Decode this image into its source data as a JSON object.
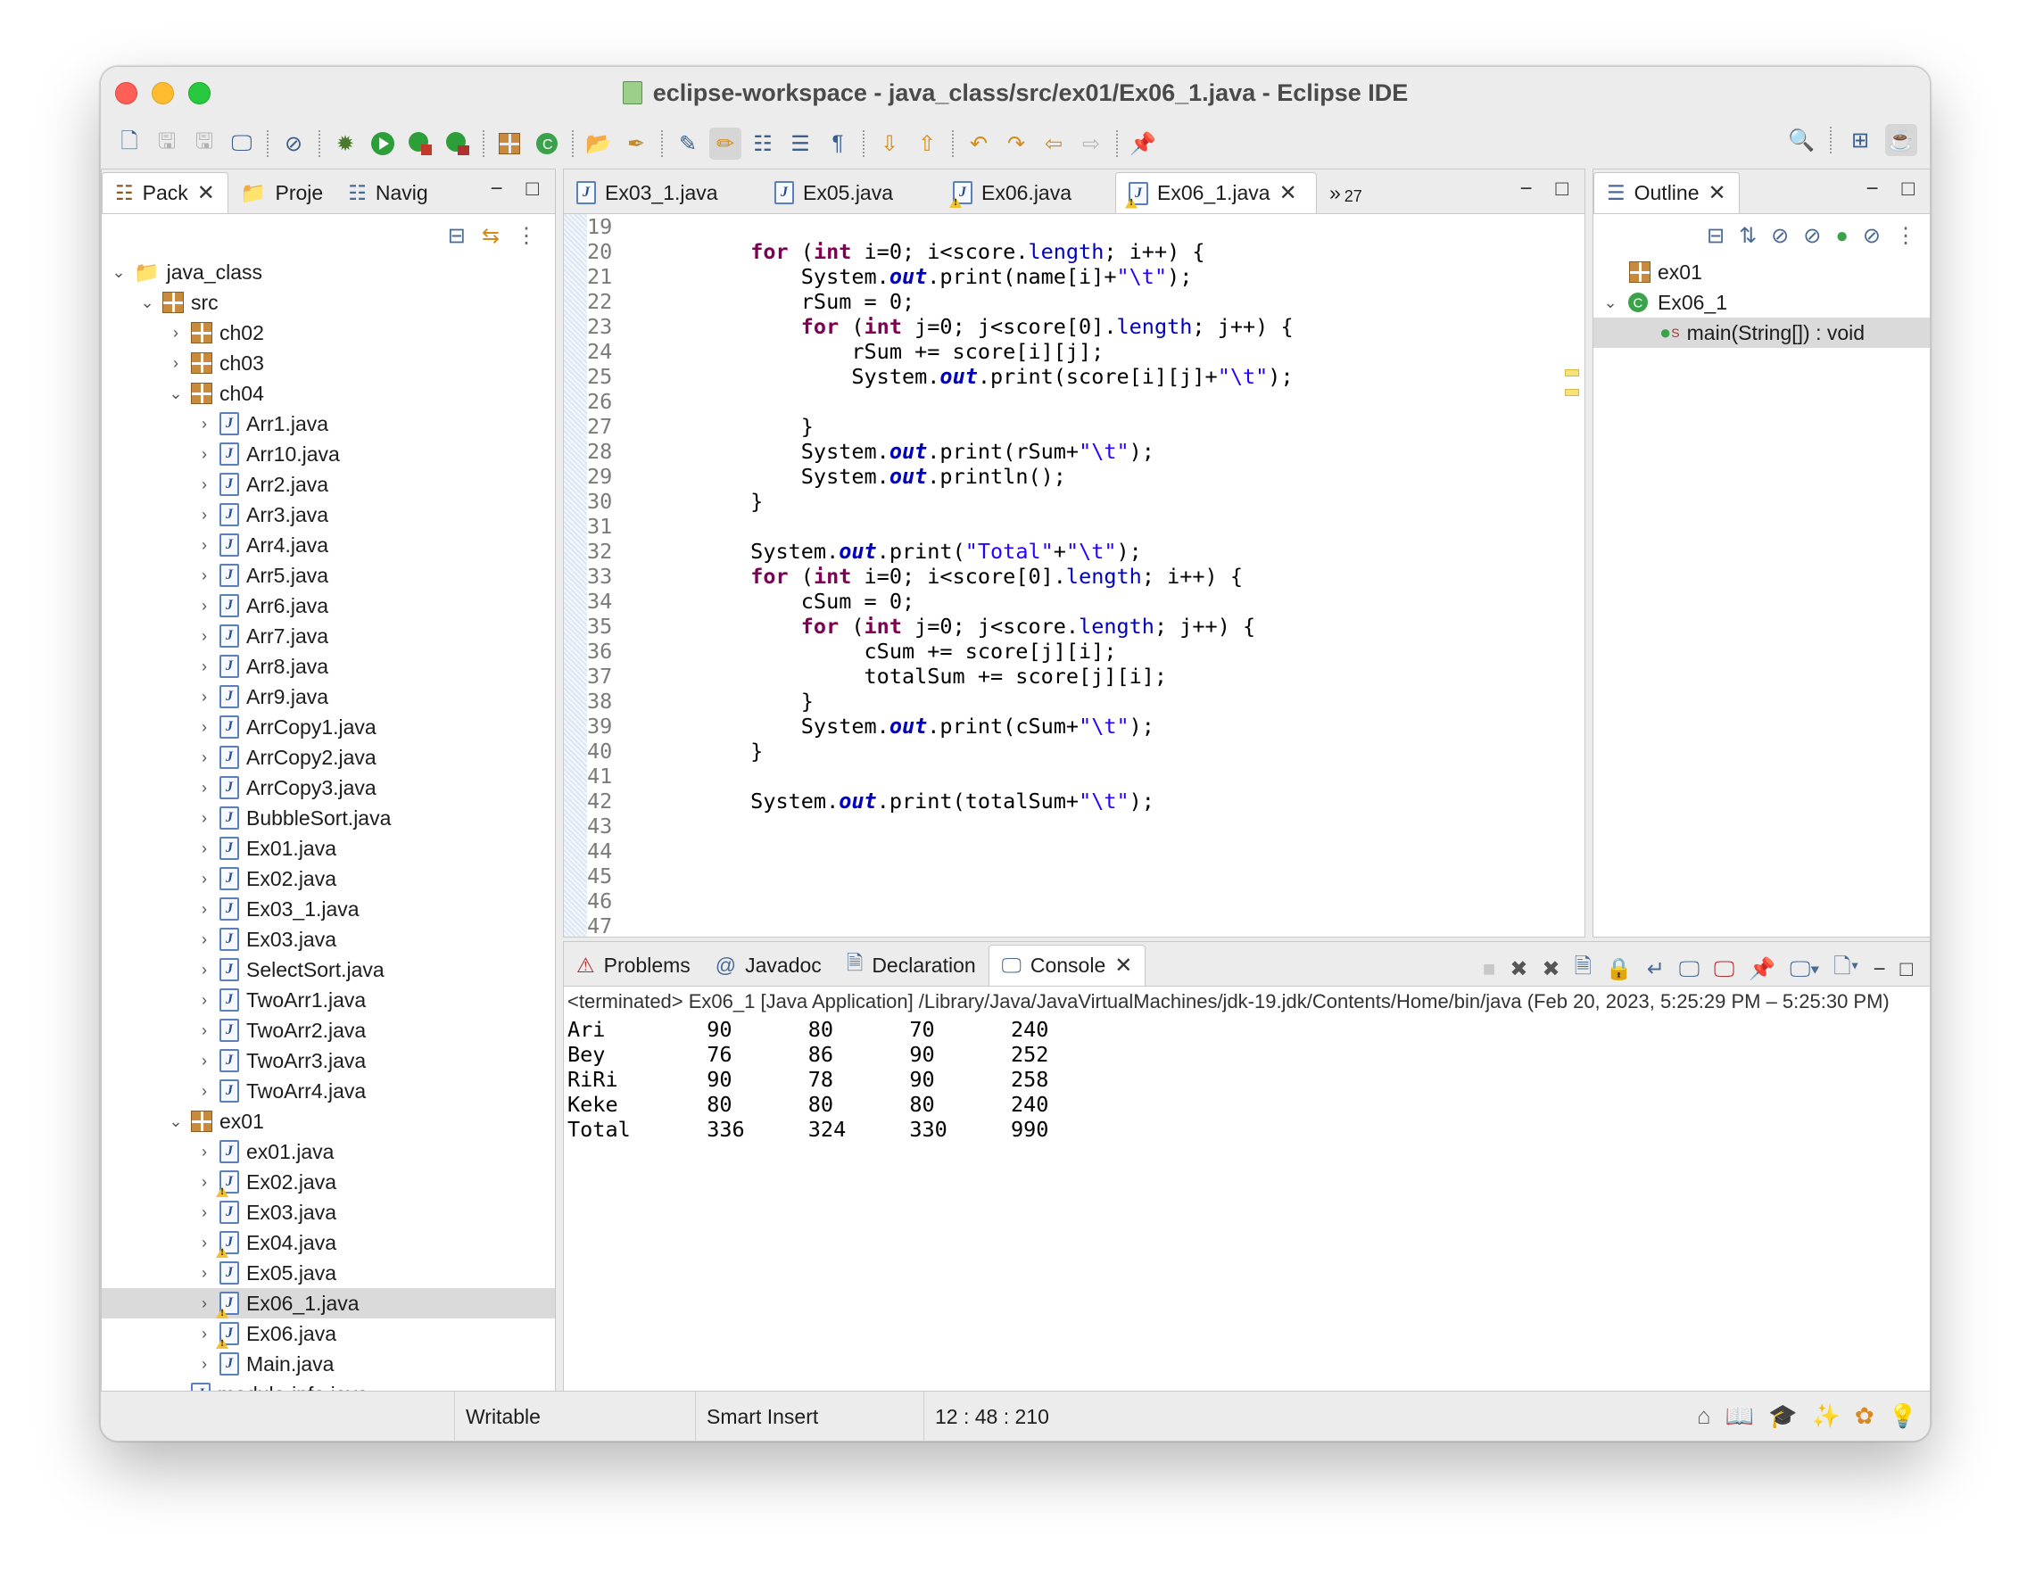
{
  "window": {
    "title": "eclipse-workspace - java_class/src/ex01/Ex06_1.java - Eclipse IDE"
  },
  "toolbar": {
    "icons": [
      "new-wizard-icon",
      "save-icon",
      "save-all-icon",
      "terminal-icon",
      "skip-breakpoints-icon",
      "debug-icon",
      "run-icon",
      "coverage-icon",
      "external-tools-icon",
      "new-java-package-icon",
      "new-java-class-icon",
      "open-type-icon",
      "search-icon",
      "toggle-mark-occurrences-icon",
      "highlight-icon",
      "block-selection-icon",
      "show-whitespace-icon",
      "next-annotation-icon",
      "previous-annotation-icon",
      "last-edit-location-icon",
      "back-icon",
      "forward-icon",
      "pin-editor-icon"
    ]
  },
  "explorer": {
    "tabs": [
      {
        "label": "Pack"
      },
      {
        "label": "Proje"
      },
      {
        "label": "Navig"
      }
    ],
    "tree": [
      {
        "label": "java_class",
        "indent": 0,
        "type": "project",
        "expanded": true
      },
      {
        "label": "src",
        "indent": 1,
        "type": "srcfolder",
        "expanded": true
      },
      {
        "label": "ch02",
        "indent": 2,
        "type": "package",
        "expanded": false
      },
      {
        "label": "ch03",
        "indent": 2,
        "type": "package",
        "expanded": false
      },
      {
        "label": "ch04",
        "indent": 2,
        "type": "package",
        "expanded": true
      },
      {
        "label": "Arr1.java",
        "indent": 3,
        "type": "file"
      },
      {
        "label": "Arr10.java",
        "indent": 3,
        "type": "file"
      },
      {
        "label": "Arr2.java",
        "indent": 3,
        "type": "file"
      },
      {
        "label": "Arr3.java",
        "indent": 3,
        "type": "file"
      },
      {
        "label": "Arr4.java",
        "indent": 3,
        "type": "file"
      },
      {
        "label": "Arr5.java",
        "indent": 3,
        "type": "file"
      },
      {
        "label": "Arr6.java",
        "indent": 3,
        "type": "file"
      },
      {
        "label": "Arr7.java",
        "indent": 3,
        "type": "file"
      },
      {
        "label": "Arr8.java",
        "indent": 3,
        "type": "file"
      },
      {
        "label": "Arr9.java",
        "indent": 3,
        "type": "file"
      },
      {
        "label": "ArrCopy1.java",
        "indent": 3,
        "type": "file"
      },
      {
        "label": "ArrCopy2.java",
        "indent": 3,
        "type": "file"
      },
      {
        "label": "ArrCopy3.java",
        "indent": 3,
        "type": "file"
      },
      {
        "label": "BubbleSort.java",
        "indent": 3,
        "type": "file"
      },
      {
        "label": "Ex01.java",
        "indent": 3,
        "type": "file"
      },
      {
        "label": "Ex02.java",
        "indent": 3,
        "type": "file"
      },
      {
        "label": "Ex03_1.java",
        "indent": 3,
        "type": "file"
      },
      {
        "label": "Ex03.java",
        "indent": 3,
        "type": "file"
      },
      {
        "label": "SelectSort.java",
        "indent": 3,
        "type": "file"
      },
      {
        "label": "TwoArr1.java",
        "indent": 3,
        "type": "file"
      },
      {
        "label": "TwoArr2.java",
        "indent": 3,
        "type": "file"
      },
      {
        "label": "TwoArr3.java",
        "indent": 3,
        "type": "file"
      },
      {
        "label": "TwoArr4.java",
        "indent": 3,
        "type": "file"
      },
      {
        "label": "ex01",
        "indent": 2,
        "type": "package",
        "expanded": true
      },
      {
        "label": "ex01.java",
        "indent": 3,
        "type": "file"
      },
      {
        "label": "Ex02.java",
        "indent": 3,
        "type": "file",
        "warn": true
      },
      {
        "label": "Ex03.java",
        "indent": 3,
        "type": "file"
      },
      {
        "label": "Ex04.java",
        "indent": 3,
        "type": "file",
        "warn": true
      },
      {
        "label": "Ex05.java",
        "indent": 3,
        "type": "file"
      },
      {
        "label": "Ex06_1.java",
        "indent": 3,
        "type": "file",
        "warn": true,
        "selected": true
      },
      {
        "label": "Ex06.java",
        "indent": 3,
        "type": "file",
        "warn": true
      },
      {
        "label": "Main.java",
        "indent": 3,
        "type": "file"
      },
      {
        "label": "module-info.java",
        "indent": 2,
        "type": "file"
      }
    ]
  },
  "editor": {
    "tabs": [
      {
        "label": "Ex03_1.java",
        "warn": false
      },
      {
        "label": "Ex05.java",
        "warn": false
      },
      {
        "label": "Ex06.java",
        "warn": true
      },
      {
        "label": "Ex06_1.java",
        "warn": true,
        "active": true
      }
    ],
    "overflow": "27",
    "line_numbers": [
      "19",
      "20",
      "21",
      "22",
      "23",
      "24",
      "25",
      "26",
      "27",
      "28",
      "29",
      "30",
      "31",
      "32",
      "33",
      "34",
      "35",
      "36",
      "37",
      "38",
      "39",
      "40",
      "41",
      "42",
      "43",
      "44",
      "45",
      "46",
      "47"
    ]
  },
  "outline": {
    "tab": "Outline",
    "items": [
      {
        "label": "ex01",
        "kind": "package"
      },
      {
        "label": "Ex06_1",
        "kind": "class"
      },
      {
        "label": "main(String[]) : void",
        "kind": "method",
        "marker": "S"
      }
    ]
  },
  "bottom": {
    "tabs": [
      {
        "label": "Problems"
      },
      {
        "label": "Javadoc"
      },
      {
        "label": "Declaration"
      },
      {
        "label": "Console",
        "active": true
      }
    ],
    "terminated": "<terminated> Ex06_1 [Java Application] /Library/Java/JavaVirtualMachines/jdk-19.jdk/Contents/Home/bin/java  (Feb 20, 2023, 5:25:29 PM – 5:25:30 PM)",
    "output": [
      [
        "Ari",
        "90",
        "80",
        "70",
        "240"
      ],
      [
        "Bey",
        "76",
        "86",
        "90",
        "252"
      ],
      [
        "RiRi",
        "90",
        "78",
        "90",
        "258"
      ],
      [
        "Keke",
        "80",
        "80",
        "80",
        "240"
      ],
      [
        "Total",
        "336",
        "324",
        "330",
        "990"
      ]
    ]
  },
  "status": {
    "writable": "Writable",
    "insert_mode": "Smart Insert",
    "position": "12 : 48 : 210"
  }
}
